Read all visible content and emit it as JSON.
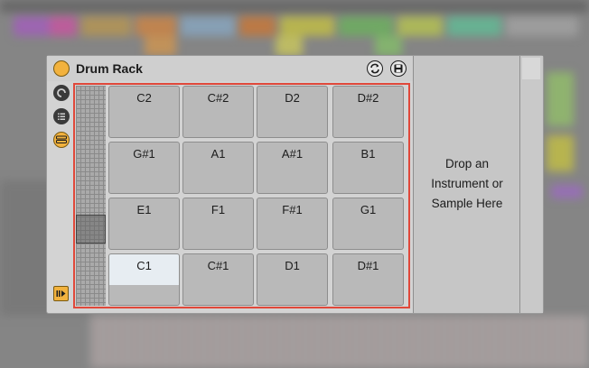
{
  "device": {
    "title": "Drum Rack",
    "drop_text": {
      "line1": "Drop an",
      "line2": "Instrument or",
      "line3": "Sample Here"
    }
  },
  "pads": {
    "row1": [
      "C2",
      "C#2",
      "D2",
      "D#2"
    ],
    "row2": [
      "G#1",
      "A1",
      "A#1",
      "B1"
    ],
    "row3": [
      "E1",
      "F1",
      "F#1",
      "G1"
    ],
    "row4": [
      "C1",
      "C#1",
      "D1",
      "D#1"
    ]
  },
  "selected_pad": "C1",
  "colors": {
    "accent_led": "#f2b23e",
    "highlight_frame": "#e0483a",
    "selected_pad": "#e7edf2"
  },
  "icons": {
    "hot_swap": "hot-swap-icon",
    "save": "save-icon",
    "chain_toggle": "chain-view-icon",
    "list": "list-icon",
    "pads_view": "pads-view-icon",
    "io": "io-arrow-icon"
  }
}
